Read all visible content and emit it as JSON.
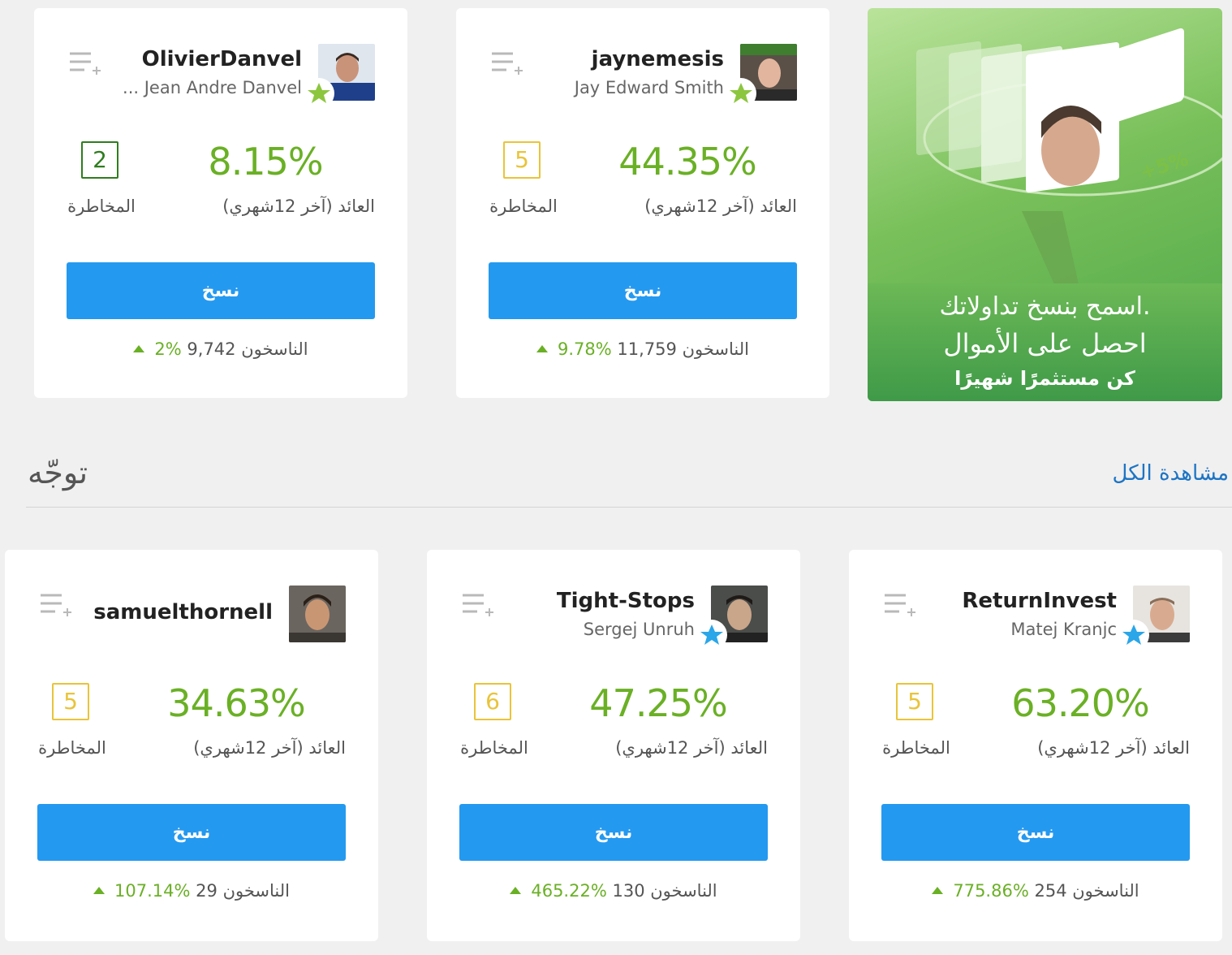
{
  "banner": {
    "line1": "اسمح بنسخ تداولاتك.",
    "line2": "احصل على الأموال",
    "line3": "كن مستثمرًا شهيرًا",
    "badge": "+5%"
  },
  "section": {
    "title": "توجّه",
    "see_all": "مشاهدة الكل"
  },
  "labels": {
    "risk": "المخاطرة",
    "gain": "العائد (آخر 12شهري)",
    "copy": "نسخ",
    "copiers": "الناسخون"
  },
  "colors": {
    "gain_green": "#6ab025",
    "copy_blue": "#2499f0",
    "risk_green": "#2f7d1e",
    "risk_yellow": "#e9c43a",
    "star_green": "#8cc63f",
    "star_blue": "#2aa6e9",
    "link_blue": "#1d74c4"
  },
  "cards": [
    {
      "username": "OlivierDanvel",
      "fullname": "... Jean Andre Danvel",
      "risk": "2",
      "risk_color": "green",
      "gain": "8.15%",
      "copiers_count": "9,742",
      "copiers_change": "2%",
      "star": "green-star-icon"
    },
    {
      "username": "jaynemesis",
      "fullname": "Jay Edward Smith",
      "risk": "5",
      "risk_color": "yellow",
      "gain": "44.35%",
      "copiers_count": "11,759",
      "copiers_change": "9.78%",
      "star": "green-star-icon"
    },
    {
      "username": "samuelthornell",
      "fullname": "",
      "risk": "5",
      "risk_color": "yellow",
      "gain": "34.63%",
      "copiers_count": "29",
      "copiers_change": "107.14%",
      "star": ""
    },
    {
      "username": "Tight-Stops",
      "fullname": "Sergej Unruh",
      "risk": "6",
      "risk_color": "yellow",
      "gain": "47.25%",
      "copiers_count": "130",
      "copiers_change": "465.22%",
      "star": "blue-star-icon"
    },
    {
      "username": "ReturnInvest",
      "fullname": "Matej Kranjc",
      "risk": "5",
      "risk_color": "yellow",
      "gain": "63.20%",
      "copiers_count": "254",
      "copiers_change": "775.86%",
      "star": "blue-star-icon"
    }
  ]
}
